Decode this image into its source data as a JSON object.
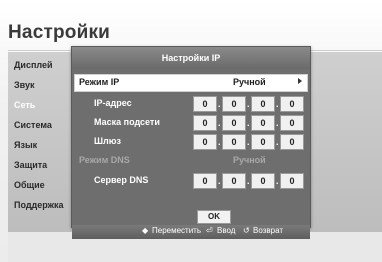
{
  "page": {
    "title": "Настройки"
  },
  "sidebar": {
    "items": [
      {
        "label": "Дисплей",
        "active": false
      },
      {
        "label": "Звук",
        "active": false
      },
      {
        "label": "Сеть",
        "active": true
      },
      {
        "label": "Система",
        "active": false
      },
      {
        "label": "Язык",
        "active": false
      },
      {
        "label": "Защита",
        "active": false
      },
      {
        "label": "Общие",
        "active": false
      },
      {
        "label": "Поддержка",
        "active": false
      }
    ]
  },
  "dialog": {
    "title": "Настройки IP",
    "ip_mode": {
      "label": "Режим IP",
      "value": "Ручной"
    },
    "ip_address": {
      "label": "IP-адрес",
      "octets": [
        "0",
        "0",
        "0",
        "0"
      ]
    },
    "subnet_mask": {
      "label": "Маска подсети",
      "octets": [
        "0",
        "0",
        "0",
        "0"
      ]
    },
    "gateway": {
      "label": "Шлюз",
      "octets": [
        "0",
        "0",
        "0",
        "0"
      ]
    },
    "dns_mode": {
      "label": "Режим DNS",
      "value": "Ручной"
    },
    "dns_server": {
      "label": "Сервер DNS",
      "octets": [
        "0",
        "0",
        "0",
        "0"
      ]
    },
    "ok_label": "OK"
  },
  "hints": {
    "move_icon": "◆",
    "move": "Переместить",
    "enter_icon": "⏎",
    "enter": "Ввод",
    "return_icon": "↺",
    "return": "Возврат"
  },
  "colors": {
    "dialog_bg": "#6e6e6e",
    "selected_row_bg": "#ffffff",
    "active_sidebar_text": "#ffffff"
  }
}
